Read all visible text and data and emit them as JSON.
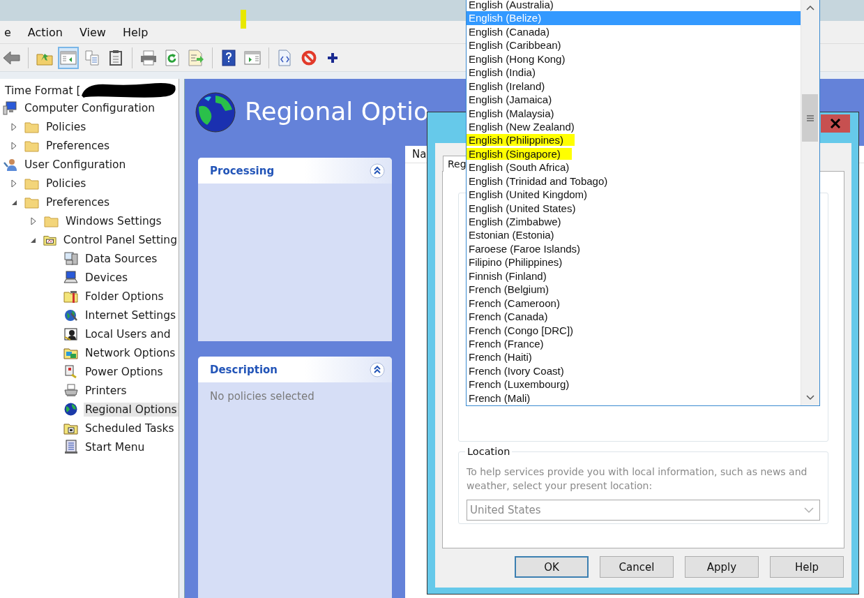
{
  "title_bar": {
    "highlight_mark": true
  },
  "menu": [
    {
      "label": "e"
    },
    {
      "label": "Action"
    },
    {
      "label": "View"
    },
    {
      "label": "Help"
    }
  ],
  "toolbar": [
    {
      "kind": "back",
      "pressed": false
    },
    {
      "kind": "separator"
    },
    {
      "kind": "up",
      "pressed": false
    },
    {
      "kind": "tree",
      "pressed": true
    },
    {
      "kind": "copy",
      "pressed": false
    },
    {
      "kind": "paste",
      "pressed": false
    },
    {
      "kind": "separator"
    },
    {
      "kind": "print",
      "pressed": false
    },
    {
      "kind": "refresh",
      "pressed": false
    },
    {
      "kind": "export",
      "pressed": false
    },
    {
      "kind": "separator"
    },
    {
      "kind": "help",
      "pressed": false
    },
    {
      "kind": "pane",
      "pressed": false
    },
    {
      "kind": "separator"
    },
    {
      "kind": "doc",
      "pressed": false
    },
    {
      "kind": "stop",
      "pressed": false
    },
    {
      "kind": "add",
      "pressed": false
    }
  ],
  "tree": {
    "header": "Time Format [",
    "redacted": true,
    "items": [
      {
        "label": "Computer Configuration",
        "kind": "computer",
        "selected": false,
        "children": [
          {
            "label": "Policies",
            "kind": "folder",
            "expanded": false,
            "selected": false
          },
          {
            "label": "Preferences",
            "kind": "folder",
            "expanded": false,
            "selected": false
          }
        ]
      },
      {
        "label": "User Configuration",
        "kind": "user",
        "selected": false,
        "children": [
          {
            "label": "Policies",
            "kind": "folder",
            "expanded": false,
            "selected": false
          },
          {
            "label": "Preferences",
            "kind": "folder",
            "expanded": true,
            "selected": false,
            "children": [
              {
                "label": "Windows Settings",
                "kind": "folder",
                "expanded": false,
                "selected": false
              },
              {
                "label": "Control Panel Setting",
                "kind": "panel",
                "expanded": true,
                "selected": false,
                "children": [
                  {
                    "label": "Data Sources",
                    "kind": "datasource",
                    "selected": false
                  },
                  {
                    "label": "Devices",
                    "kind": "device",
                    "selected": false
                  },
                  {
                    "label": "Folder Options",
                    "kind": "tools",
                    "selected": false
                  },
                  {
                    "label": "Internet Settings",
                    "kind": "internet",
                    "selected": false
                  },
                  {
                    "label": "Local Users and",
                    "kind": "users",
                    "selected": false
                  },
                  {
                    "label": "Network Options",
                    "kind": "network",
                    "selected": false
                  },
                  {
                    "label": "Power Options",
                    "kind": "power",
                    "selected": false
                  },
                  {
                    "label": "Printers",
                    "kind": "printer",
                    "selected": false
                  },
                  {
                    "label": "Regional Options",
                    "kind": "globe",
                    "selected": true
                  },
                  {
                    "label": "Scheduled Tasks",
                    "kind": "tasks",
                    "selected": false
                  },
                  {
                    "label": "Start Menu",
                    "kind": "startmenu",
                    "selected": false
                  }
                ]
              }
            ]
          }
        ]
      }
    ]
  },
  "console": {
    "title": "Regional Optio",
    "panels": [
      {
        "title": "Processing",
        "expanded": true
      },
      {
        "title": "Description",
        "expanded": true,
        "text": "No policies selected"
      }
    ],
    "list": {
      "columns": [
        "Na"
      ]
    }
  },
  "dialog": {
    "tab": {
      "label": "Reg",
      "selected": true
    },
    "location": {
      "label": "Location",
      "text": "To help services provide you with local information, such as news and weather, select your present location:",
      "value": "United States",
      "disabled": true
    },
    "buttons": [
      {
        "label": "OK",
        "default": true
      },
      {
        "label": "Cancel",
        "default": false
      },
      {
        "label": "Apply",
        "default": false
      },
      {
        "label": "Help",
        "default": false
      }
    ]
  },
  "dropdown": {
    "items": [
      {
        "label": "English (Australia)",
        "selected": false,
        "highlighted": false
      },
      {
        "label": "English (Belize)",
        "selected": true,
        "highlighted": false
      },
      {
        "label": "English (Canada)",
        "selected": false,
        "highlighted": false
      },
      {
        "label": "English (Caribbean)",
        "selected": false,
        "highlighted": false
      },
      {
        "label": "English (Hong Kong)",
        "selected": false,
        "highlighted": false
      },
      {
        "label": "English (India)",
        "selected": false,
        "highlighted": false
      },
      {
        "label": "English (Ireland)",
        "selected": false,
        "highlighted": false
      },
      {
        "label": "English (Jamaica)",
        "selected": false,
        "highlighted": false
      },
      {
        "label": "English (Malaysia)",
        "selected": false,
        "highlighted": false
      },
      {
        "label": "English (New Zealand)",
        "selected": false,
        "highlighted": false
      },
      {
        "label": "English (Philippines)",
        "selected": false,
        "highlighted": true
      },
      {
        "label": "English (Singapore)",
        "selected": false,
        "highlighted": true
      },
      {
        "label": "English (South Africa)",
        "selected": false,
        "highlighted": false
      },
      {
        "label": "English (Trinidad and Tobago)",
        "selected": false,
        "highlighted": false
      },
      {
        "label": "English (United Kingdom)",
        "selected": false,
        "highlighted": false
      },
      {
        "label": "English (United States)",
        "selected": false,
        "highlighted": false
      },
      {
        "label": "English (Zimbabwe)",
        "selected": false,
        "highlighted": false
      },
      {
        "label": "Estonian (Estonia)",
        "selected": false,
        "highlighted": false
      },
      {
        "label": "Faroese (Faroe Islands)",
        "selected": false,
        "highlighted": false
      },
      {
        "label": "Filipino (Philippines)",
        "selected": false,
        "highlighted": false
      },
      {
        "label": "Finnish (Finland)",
        "selected": false,
        "highlighted": false
      },
      {
        "label": "French (Belgium)",
        "selected": false,
        "highlighted": false
      },
      {
        "label": "French (Cameroon)",
        "selected": false,
        "highlighted": false
      },
      {
        "label": "French (Canada)",
        "selected": false,
        "highlighted": false
      },
      {
        "label": "French (Congo [DRC])",
        "selected": false,
        "highlighted": false
      },
      {
        "label": "French (France)",
        "selected": false,
        "highlighted": false
      },
      {
        "label": "French (Haiti)",
        "selected": false,
        "highlighted": false
      },
      {
        "label": "French (Ivory Coast)",
        "selected": false,
        "highlighted": false
      },
      {
        "label": "French (Luxembourg)",
        "selected": false,
        "highlighted": false
      },
      {
        "label": "French (Mali)",
        "selected": false,
        "highlighted": false
      }
    ]
  }
}
